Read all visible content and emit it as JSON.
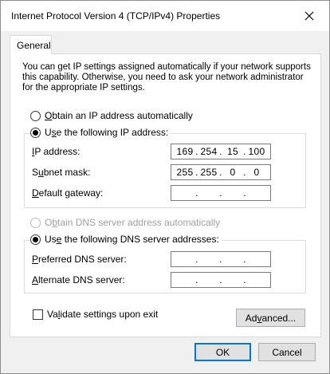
{
  "window": {
    "title": "Internet Protocol Version 4 (TCP/IPv4) Properties"
  },
  "tabs": [
    {
      "label": "General"
    }
  ],
  "description": [
    "You can get IP settings assigned automatically if your network supports",
    "this capability. Otherwise, you need to ask your network administrator",
    "for the appropriate IP settings."
  ],
  "ip": {
    "auto_label_pre": "",
    "auto_label_key": "O",
    "auto_label_post": "btain an IP address automatically",
    "manual_label_pre": "U",
    "manual_label_key": "s",
    "manual_label_post": "e the following IP address:",
    "fields": [
      {
        "label_key": "I",
        "label_rest": "P address:",
        "octets": [
          "169",
          "254",
          "15",
          "100"
        ]
      },
      {
        "label_pre": "S",
        "label_key": "u",
        "label_rest": "bnet mask:",
        "octets": [
          "255",
          "255",
          "0",
          "0"
        ]
      },
      {
        "label_key": "D",
        "label_rest": "efault gateway:",
        "octets": [
          "",
          "",
          "",
          ""
        ]
      }
    ]
  },
  "dns": {
    "auto_label_pre": "O",
    "auto_label_key": "b",
    "auto_label_post": "tain DNS server address automatically",
    "manual_label_pre": "Us",
    "manual_label_key": "e",
    "manual_label_post": " the following DNS server addresses:",
    "fields": [
      {
        "label_key": "P",
        "label_rest": "referred DNS server:",
        "octets": [
          "",
          "",
          "",
          ""
        ]
      },
      {
        "label_key": "A",
        "label_rest": "lternate DNS server:",
        "octets": [
          "",
          "",
          "",
          ""
        ]
      }
    ]
  },
  "validate": {
    "label_pre": "Va",
    "label_key": "l",
    "label_post": "idate settings upon exit",
    "checked": false
  },
  "buttons": {
    "advanced_pre": "Ad",
    "advanced_key": "v",
    "advanced_post": "anced...",
    "ok": "OK",
    "cancel": "Cancel"
  },
  "colors": {
    "accent": "#0078d7",
    "window_bg": "#f0f0f0",
    "panel_bg": "#ffffff"
  }
}
